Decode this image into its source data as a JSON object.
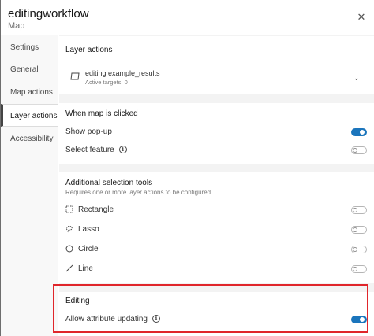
{
  "header": {
    "title": "editingworkflow",
    "subtitle": "Map"
  },
  "sidebar": {
    "items": [
      {
        "label": "Settings"
      },
      {
        "label": "General"
      },
      {
        "label": "Map actions"
      },
      {
        "label": "Layer actions",
        "active": true
      },
      {
        "label": "Accessibility"
      }
    ]
  },
  "layer_actions": {
    "title": "Layer actions",
    "layer_name": "editing example_results",
    "active_targets": "Active targets: 0"
  },
  "when_clicked": {
    "title": "When map is clicked",
    "show_popup": {
      "label": "Show pop-up",
      "on": true
    },
    "select_feature": {
      "label": "Select feature",
      "on": false
    }
  },
  "selection_tools": {
    "title": "Additional selection tools",
    "description": "Requires one or more layer actions to be configured.",
    "tools": [
      {
        "label": "Rectangle",
        "icon": "rectangle-select-icon",
        "on": false
      },
      {
        "label": "Lasso",
        "icon": "lasso-icon",
        "on": false
      },
      {
        "label": "Circle",
        "icon": "circle-icon",
        "on": false
      },
      {
        "label": "Line",
        "icon": "line-icon",
        "on": false
      }
    ]
  },
  "editing": {
    "title": "Editing",
    "allow_attribute_updating": {
      "label": "Allow attribute updating",
      "on": true
    }
  },
  "colors": {
    "accent": "#1b75bc",
    "highlight": "#e0262b"
  }
}
